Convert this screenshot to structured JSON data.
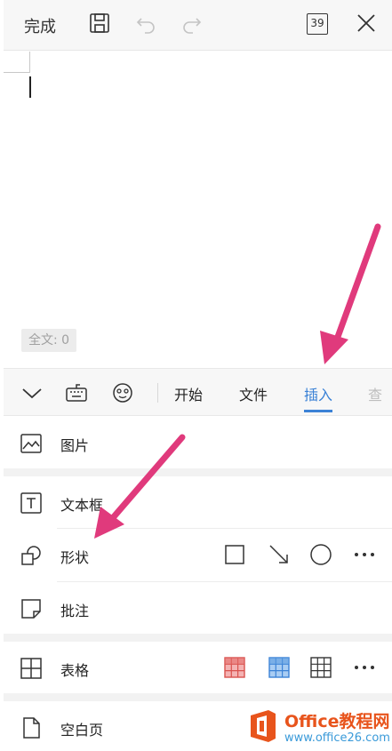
{
  "topbar": {
    "done_label": "完成",
    "page_count": "39",
    "icons": [
      "save-icon",
      "undo-icon",
      "redo-icon",
      "page-count-icon",
      "close-icon"
    ]
  },
  "editor": {
    "word_count": "全文: 0"
  },
  "ribbon": {
    "icons": [
      "collapse-icon",
      "keyboard-icon",
      "emoji-icon"
    ],
    "tabs": [
      {
        "label": "开始",
        "active": false
      },
      {
        "label": "文件",
        "active": false
      },
      {
        "label": "插入",
        "active": true
      },
      {
        "label": "查",
        "active": false
      }
    ],
    "accent": "#3b82d6"
  },
  "insert_panel": {
    "items": [
      {
        "label": "图片",
        "icon": "image-icon"
      },
      {
        "label": "文本框",
        "icon": "textbox-icon"
      },
      {
        "label": "形状",
        "icon": "shape-icon",
        "options": [
          "square-shape-icon",
          "arrow-line-icon",
          "circle-shape-icon",
          "more-icon"
        ]
      },
      {
        "label": "批注",
        "icon": "comment-icon"
      },
      {
        "label": "表格",
        "icon": "table-icon",
        "options": [
          "red-table-icon",
          "blue-table-icon",
          "plain-table-icon",
          "more-icon"
        ]
      },
      {
        "label": "空白页",
        "icon": "blank-page-icon"
      }
    ]
  },
  "annotation_color": "#e03a7c",
  "watermark": {
    "brand": "Office教程网",
    "url": "www.office26.com"
  }
}
